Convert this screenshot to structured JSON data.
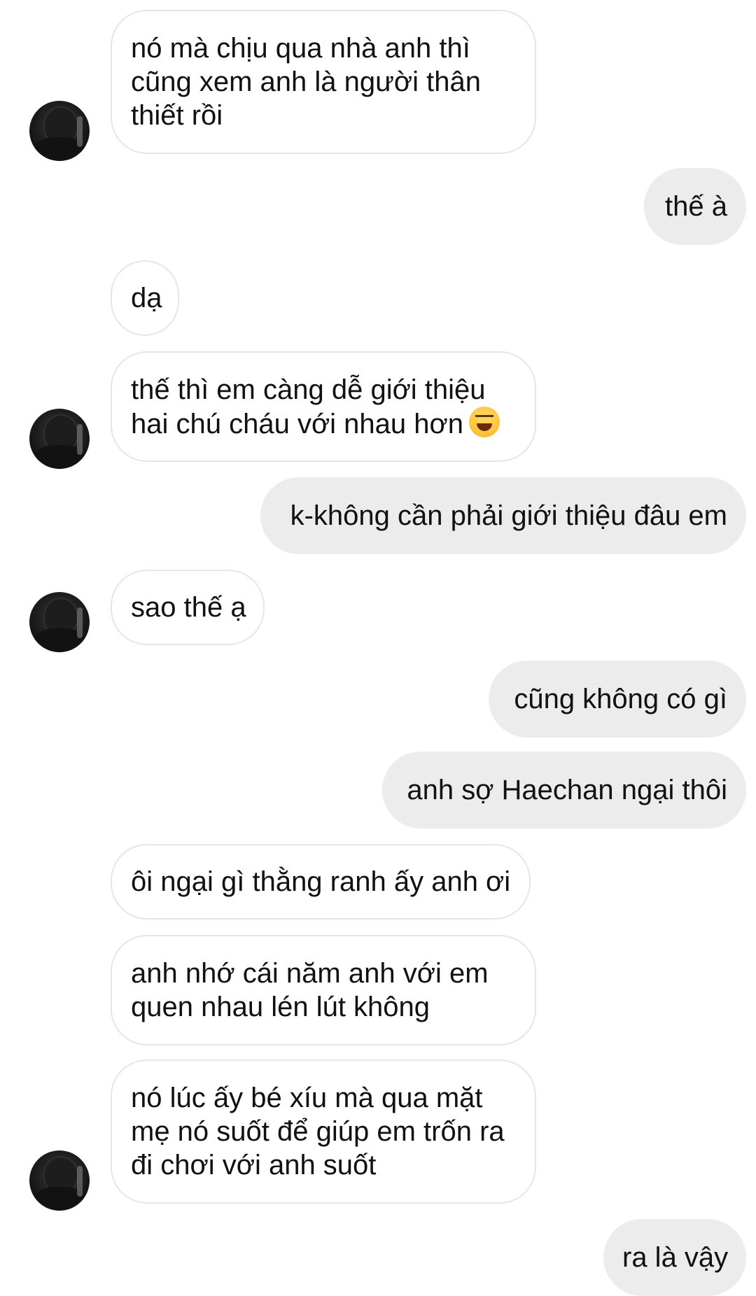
{
  "messages": [
    {
      "side": "in",
      "lines": [
        "nó mà chịu qua nhà anh thì",
        "cũng xem anh là người thân",
        "thiết rồi"
      ]
    },
    {
      "side": "out",
      "lines": [
        "thế à"
      ]
    },
    {
      "side": "in",
      "lines": [
        "dạ"
      ]
    },
    {
      "side": "in",
      "lines": [
        "thế thì em càng dễ giới thiệu",
        "hai chú cháu với nhau hơn"
      ],
      "emoji": "grinning-squinting-face"
    },
    {
      "side": "out",
      "lines": [
        "k-không cần phải giới thiệu đâu em"
      ]
    },
    {
      "side": "in",
      "lines": [
        "sao thế ạ"
      ]
    },
    {
      "side": "out",
      "lines": [
        "cũng không có gì"
      ]
    },
    {
      "side": "out",
      "lines": [
        "anh sợ Haechan ngại thôi"
      ]
    },
    {
      "side": "in",
      "lines": [
        "ôi ngại gì thằng ranh ấy anh ơi"
      ]
    },
    {
      "side": "in",
      "lines": [
        "anh nhớ cái năm anh với em",
        "quen nhau lén lút không"
      ]
    },
    {
      "side": "in",
      "lines": [
        "nó lúc ấy bé xíu mà qua mặt",
        "mẹ nó suốt để giúp em trốn ra",
        "đi chơi với anh suốt"
      ]
    },
    {
      "side": "out",
      "lines": [
        "ra là vậy"
      ]
    }
  ],
  "colors": {
    "incoming_bubble": "#ffffff",
    "incoming_border": "#e6e6e6",
    "outgoing_bubble": "#ececec",
    "text": "#111111"
  },
  "icons": {
    "avatar": "contact-avatar",
    "emoji": "grinning-squinting-face-emoji"
  }
}
